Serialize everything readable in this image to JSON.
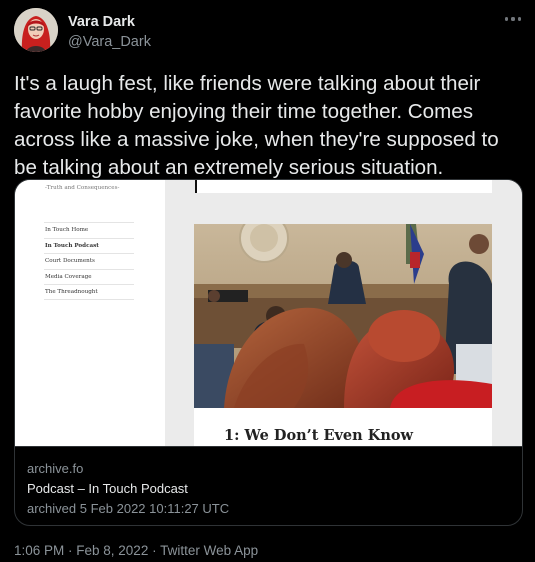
{
  "author": {
    "display_name": "Vara Dark",
    "handle": "@Vara_Dark"
  },
  "tweet": {
    "text": "It's a laugh fest, like friends were talking about their favorite hobby enjoying their time together. Comes across like a massive joke, when they're supposed to be talking about an extremely serious situation.",
    "timestamp": "1:06 PM · Feb 8, 2022 · Twitter Web App"
  },
  "link_card": {
    "domain": "archive.fo",
    "title": "Podcast – In Touch Podcast",
    "description": "archived 5 Feb 2022 10:11:27 UTC",
    "preview": {
      "tagline": "-Truth and Consequences-",
      "nav_items": [
        "In Touch Home",
        "In Touch Podcast",
        "Court Documents",
        "Media Coverage",
        "The Threadnought"
      ],
      "episode_heading": "1: We Don’t Even Know"
    }
  },
  "icons": {
    "more": "more-dots-icon",
    "avatar": "profile-avatar"
  }
}
